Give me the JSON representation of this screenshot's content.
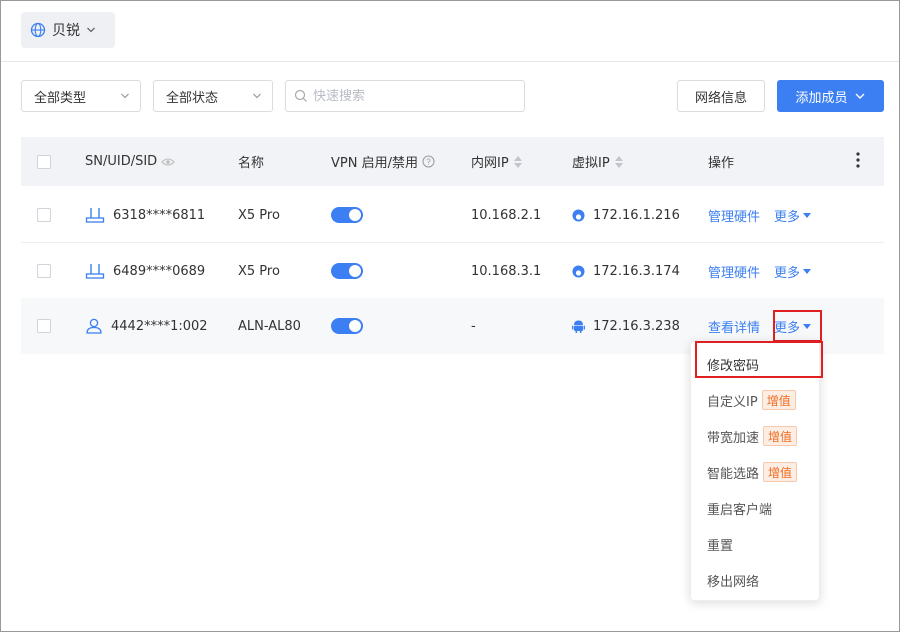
{
  "org": {
    "name": "贝锐"
  },
  "toolbar": {
    "type_filter": "全部类型",
    "status_filter": "全部状态",
    "search_placeholder": "快速搜索",
    "network_info": "网络信息",
    "add_member": "添加成员"
  },
  "table": {
    "headers": {
      "sn": "SN/UID/SID",
      "name": "名称",
      "vpn": "VPN 启用/禁用",
      "lan_ip": "内网IP",
      "virtual_ip": "虚拟IP",
      "actions": "操作"
    },
    "rows": [
      {
        "id": "6318****6811",
        "name": "X5 Pro",
        "vpn_enabled": true,
        "lan_ip": "10.168.2.1",
        "virtual_ip": "172.16.1.216",
        "action": "管理硬件",
        "more": "更多"
      },
      {
        "id": "6489****0689",
        "name": "X5 Pro",
        "vpn_enabled": true,
        "lan_ip": "10.168.3.1",
        "virtual_ip": "172.16.3.174",
        "action": "管理硬件",
        "more": "更多"
      },
      {
        "id": "4442****1:002",
        "name": "ALN-AL80",
        "vpn_enabled": true,
        "lan_ip": "-",
        "virtual_ip": "172.16.3.238",
        "action": "查看详情",
        "more": "更多"
      }
    ]
  },
  "menu": {
    "items": [
      {
        "label": "修改密码"
      },
      {
        "label": "自定义IP",
        "tag": "增值"
      },
      {
        "label": "带宽加速",
        "tag": "增值"
      },
      {
        "label": "智能选路",
        "tag": "增值"
      },
      {
        "label": "重启客户端"
      },
      {
        "label": "重置"
      },
      {
        "label": "移出网络"
      }
    ]
  },
  "colors": {
    "accent": "#3b7ff2",
    "highlight_box": "#e02020",
    "tag": "#f06a1d"
  }
}
